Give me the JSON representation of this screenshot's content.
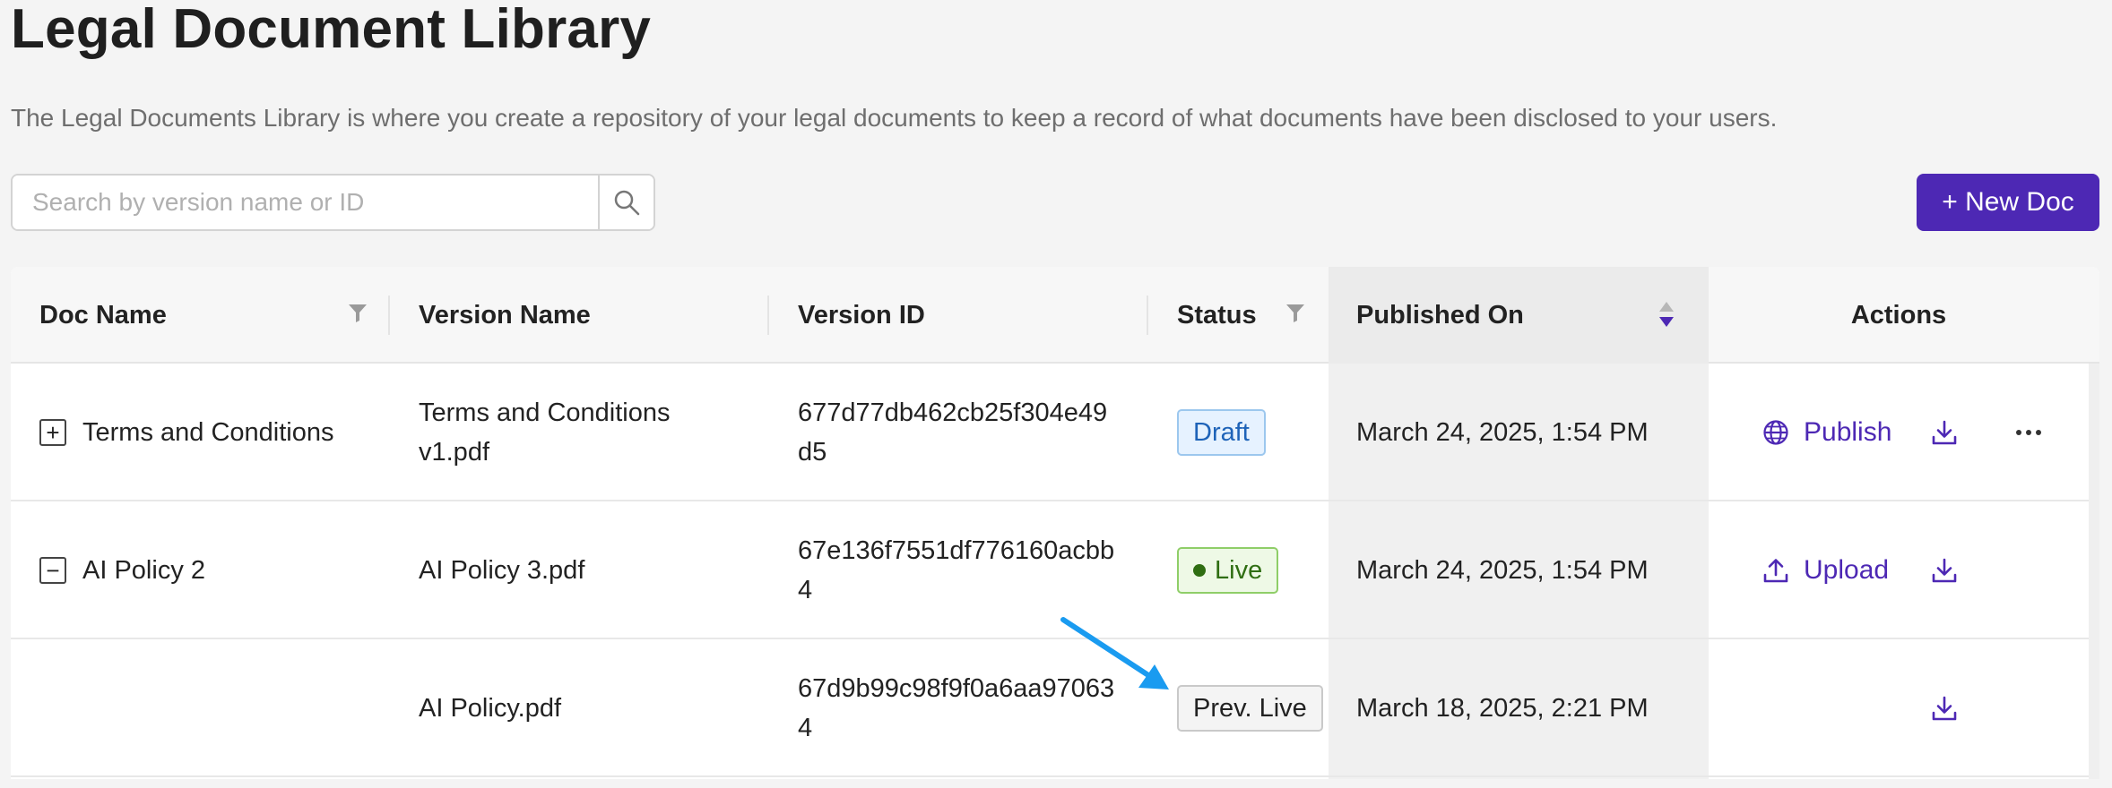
{
  "page": {
    "title": "Legal Document Library",
    "description": "The Legal Documents Library is where you create a repository of your legal documents to keep a record of what documents have been disclosed to your users."
  },
  "search": {
    "placeholder": "Search by version name or ID",
    "value": ""
  },
  "toolbar": {
    "new_doc_label": "+ New Doc",
    "accent_color": "#4d28b4"
  },
  "table": {
    "columns": {
      "doc_name": "Doc Name",
      "version_name": "Version Name",
      "version_id": "Version ID",
      "status": "Status",
      "published_on": "Published On",
      "actions": "Actions"
    },
    "rows": [
      {
        "expander": "+",
        "doc_name": "Terms and Conditions",
        "version_name_line1": "Terms and Conditions",
        "version_name_line2": "v1.pdf",
        "version_id_line1": "677d77db462cb25f304e49",
        "version_id_line2": "d5",
        "status": "Draft",
        "published_on": "March 24, 2025, 1:54 PM",
        "action_label": "Publish",
        "action_icon": "globe-icon"
      },
      {
        "expander": "−",
        "doc_name": "AI Policy 2",
        "version_name_line1": "AI Policy 3.pdf",
        "version_name_line2": "",
        "version_id_line1": "67e136f7551df776160acbb",
        "version_id_line2": "4",
        "status": "Live",
        "published_on": "March 24, 2025, 1:54 PM",
        "action_label": "Upload",
        "action_icon": "upload-icon"
      },
      {
        "expander": "",
        "doc_name": "",
        "version_name_line1": "AI Policy.pdf",
        "version_name_line2": "",
        "version_id_line1": "67d9b99c98f9f0a6aa97063",
        "version_id_line2": "4",
        "status": "Prev. Live",
        "published_on": "March 18, 2025, 2:21 PM",
        "action_label": "",
        "action_icon": ""
      }
    ]
  },
  "annotation": {
    "arrow_color": "#1a9bf0",
    "points_to": "Prev. Live"
  }
}
